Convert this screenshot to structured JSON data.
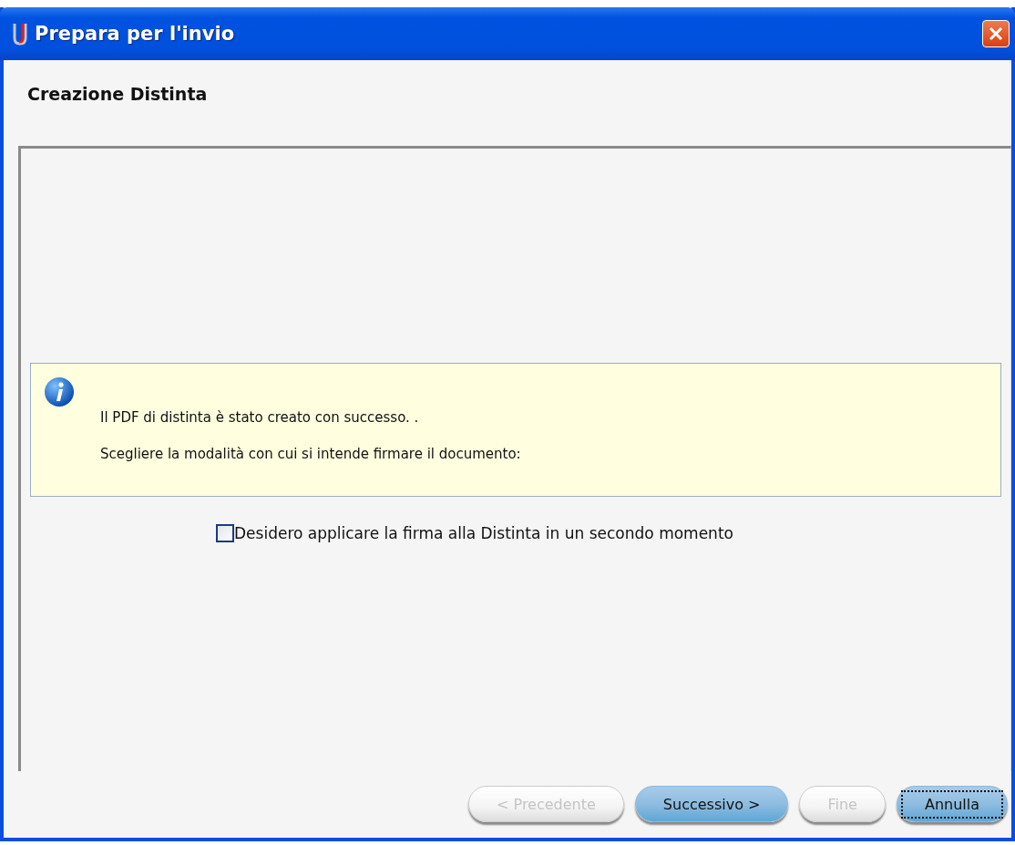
{
  "window": {
    "title": "Prepara per l'invio"
  },
  "heading": "Creazione Distinta",
  "info": {
    "lines": [
      "Il PDF di distinta è stato creato con successo. .",
      "Scegliere la modalità con cui si intende firmare il documento:"
    ]
  },
  "option": {
    "label": "Desidero applicare la firma alla Distinta in un secondo momento",
    "checked": false
  },
  "buttons": [
    {
      "label": "< Precedente",
      "disabled": true,
      "focused": false
    },
    {
      "label": "Successivo >",
      "disabled": false,
      "focused": false
    },
    {
      "label": "Fine",
      "disabled": true,
      "focused": false
    },
    {
      "label": "Annulla",
      "disabled": false,
      "focused": true
    }
  ]
}
